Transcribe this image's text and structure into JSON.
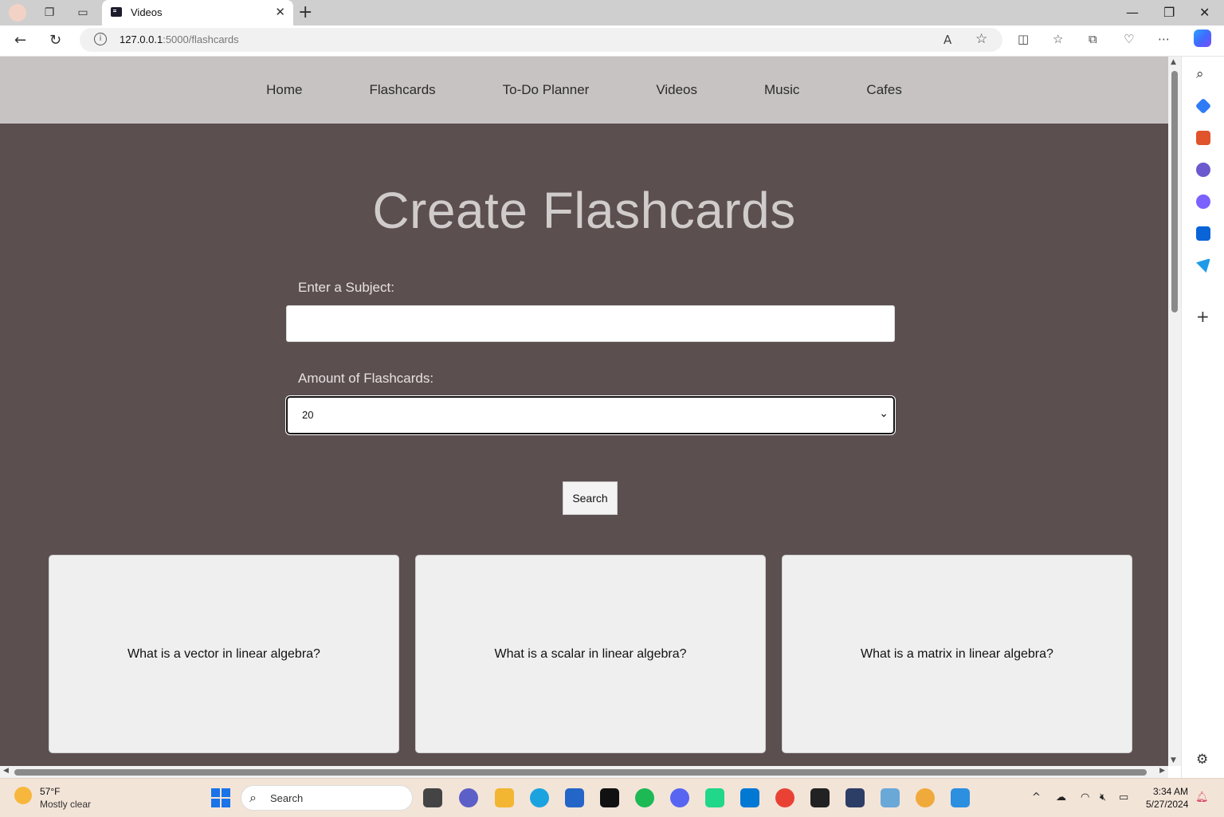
{
  "browser": {
    "tab_title": "Videos",
    "url_host": "127.0.0.1",
    "url_path": ":5000/flashcards"
  },
  "site_nav": [
    "Home",
    "Flashcards",
    "To-Do Planner",
    "Videos",
    "Music",
    "Cafes"
  ],
  "page": {
    "heading": "Create Flashcards",
    "subject_label": "Enter a Subject:",
    "subject_value": "",
    "amount_label": "Amount of Flashcards:",
    "amount_value": "20",
    "search_button": "Search"
  },
  "cards": [
    "What is a vector in linear algebra?",
    "What is a scalar in linear algebra?",
    "What is a matrix in linear algebra?"
  ],
  "taskbar": {
    "weather_temp": "57°F",
    "weather_desc": "Mostly clear",
    "search_label": "Search",
    "time": "3:34 AM",
    "date": "5/27/2024"
  },
  "colors": {
    "page_bg": "#5c4f50",
    "nav_bg": "#c8c3c3",
    "card_bg": "#efefef",
    "heading": "#d1cccc"
  }
}
